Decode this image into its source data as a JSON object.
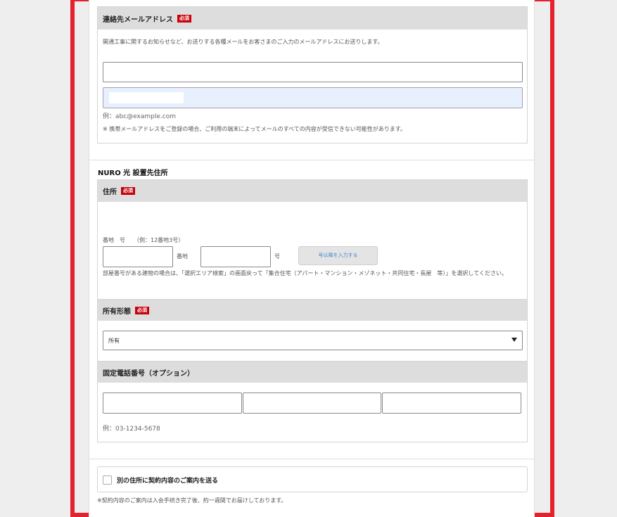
{
  "email": {
    "title": "連絡先メールアドレス",
    "required": "必須",
    "description": "開通工事に関するお知らせなど、お送りする各種メールをお客さまのご入力のメールアドレスにお送りします。",
    "input_value": "",
    "confirm_value": "",
    "example": "例：abc@example.com",
    "note": "※ 携帯メールアドレスをご登録の場合、ご利用の端末によってメールのすべての内容が受信できない可能性があります。"
  },
  "address_section": {
    "title": "NURO 光 設置先住所",
    "address": {
      "title": "住所",
      "required": "必須",
      "banchi_label": "番地　号　　（例：12番地3号）",
      "banchi_suffix": "番地",
      "go_suffix": "号",
      "go_after_button": "号以降を入力する",
      "banchi_value": "",
      "go_value": "",
      "note": "部屋番号がある建物の場合は、「選択エリア検索」の画面戻って「集合住宅（アパート・マンション・メゾネット・共同住宅・長屋　等）」を選択してください。"
    },
    "ownership": {
      "title": "所有形態",
      "required": "必須",
      "selected": "所有"
    },
    "phone": {
      "title": "固定電話番号（オプション）",
      "values": [
        "",
        "",
        ""
      ],
      "example": "例：03-1234-5678"
    }
  },
  "contract": {
    "checkbox_label": "別の住所に契約内容のご案内を送る",
    "checked": false,
    "note": "※契約内容のご案内は入会手続き完了後、約一週間でお届けしております。"
  },
  "colors": {
    "accent": "#e5222b",
    "required_badge": "#c8000a",
    "header_bg": "#dddddd",
    "autofill_bg": "#e8f0fe"
  }
}
